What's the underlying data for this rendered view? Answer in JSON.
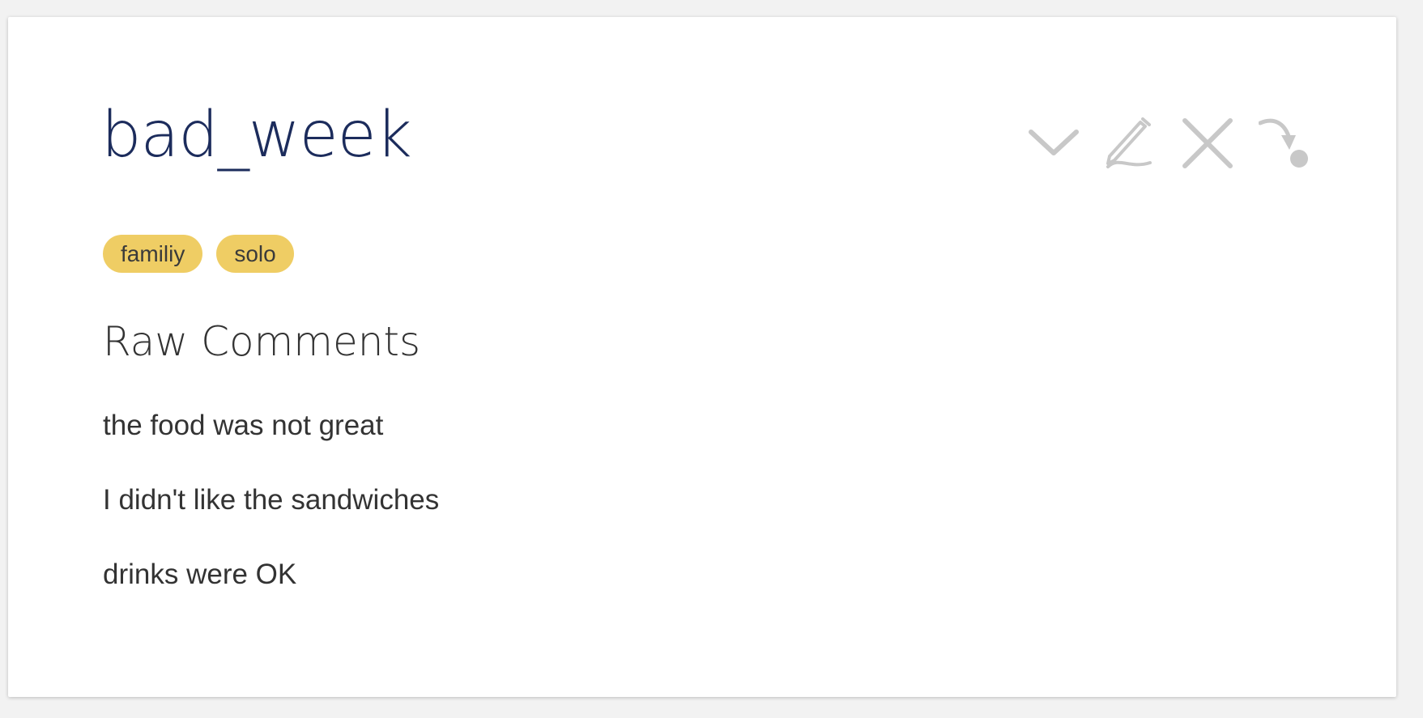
{
  "card": {
    "title": "bad_week",
    "tags": [
      "familiy",
      "solo"
    ],
    "section_title": "Raw Comments",
    "comments": [
      "the food was not great",
      "I didn't like the sandwiches",
      "drinks were OK"
    ]
  },
  "actions": [
    {
      "icon": "chevron-down-icon"
    },
    {
      "icon": "pencil-icon"
    },
    {
      "icon": "close-icon"
    },
    {
      "icon": "curved-arrow-icon"
    }
  ],
  "colors": {
    "background": "#f2f2f2",
    "card": "#ffffff",
    "title": "#1c2c5c",
    "tag": "#efcd64",
    "icon": "#c8c8c8",
    "text": "#333333"
  }
}
